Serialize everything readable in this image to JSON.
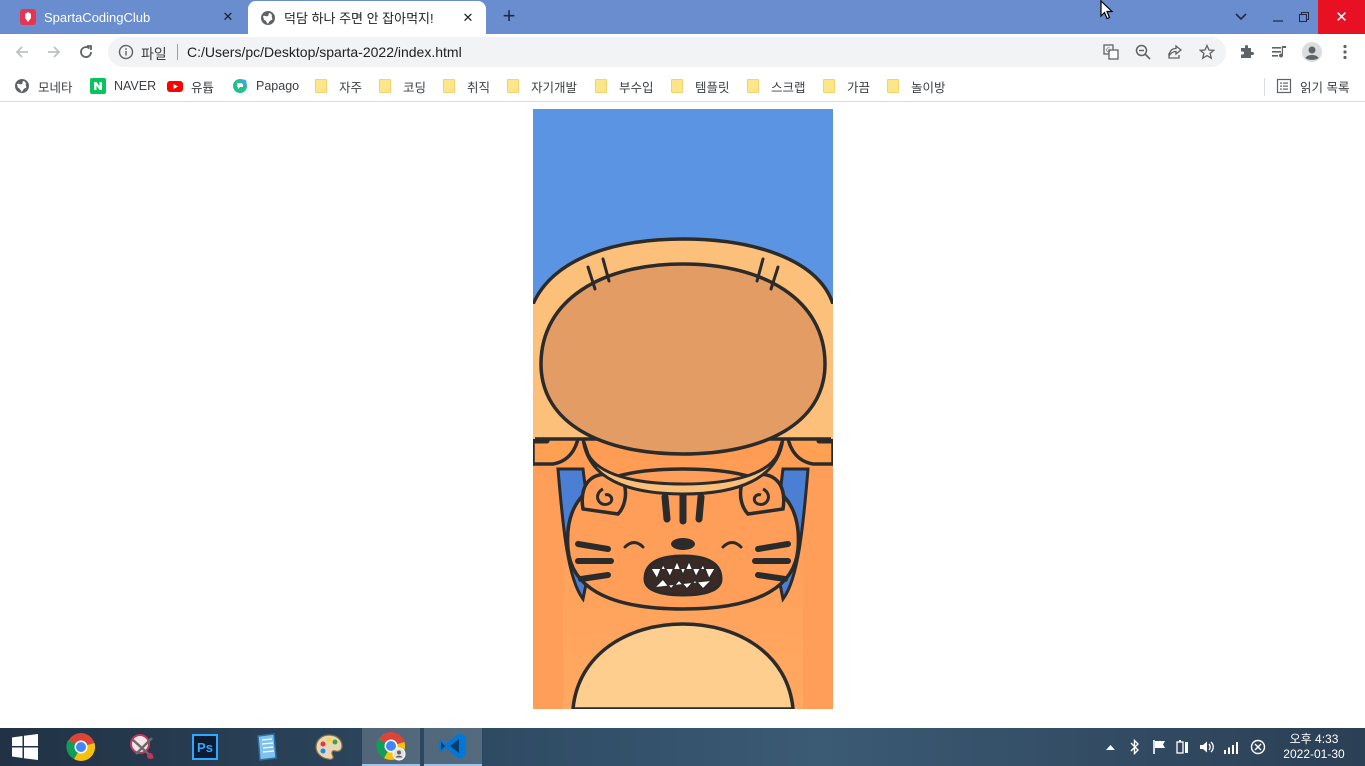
{
  "colors": {
    "tab_strip": "#6a8dcf",
    "close_button": "#e81123",
    "sky": "#5b94e3",
    "body_orange": "#ffa15a",
    "belly": "#fdce8d",
    "basket": "#e39d64"
  },
  "tabs": [
    {
      "title": "SpartaCodingClub",
      "icon": "sparta-favicon-icon",
      "active": false
    },
    {
      "title": "덕담 하나 주면 안 잡아먹지!",
      "icon": "globe-icon",
      "active": true
    }
  ],
  "window_controls": [
    "tab-search-icon",
    "minimize-icon",
    "restore-icon",
    "close-icon"
  ],
  "toolbar": {
    "back": "arrow-left-icon",
    "forward": "arrow-right-icon",
    "reload": "reload-icon",
    "site_label": "파일",
    "url": "C:/Users/pc/Desktop/sparta-2022/index.html",
    "omnibox_icons": [
      "translate-icon",
      "zoom-out-icon",
      "share-icon",
      "star-icon"
    ],
    "right_icons": [
      "extensions-icon",
      "media-icon",
      "profile-icon",
      "menu-icon"
    ]
  },
  "bookmarks": [
    {
      "label": "모네타",
      "type": "site",
      "icon": "globe-icon"
    },
    {
      "label": "NAVER",
      "type": "site",
      "icon": "naver-icon"
    },
    {
      "label": "유튭",
      "type": "site",
      "icon": "youtube-icon"
    },
    {
      "label": "Papago",
      "type": "site",
      "icon": "papago-icon"
    },
    {
      "label": "자주",
      "type": "folder",
      "icon": "folder-icon"
    },
    {
      "label": "코딩",
      "type": "folder",
      "icon": "folder-icon"
    },
    {
      "label": "취직",
      "type": "folder",
      "icon": "folder-icon"
    },
    {
      "label": "자기개발",
      "type": "folder",
      "icon": "folder-icon"
    },
    {
      "label": "부수입",
      "type": "folder",
      "icon": "folder-icon"
    },
    {
      "label": "템플릿",
      "type": "folder",
      "icon": "folder-icon"
    },
    {
      "label": "스크랩",
      "type": "folder",
      "icon": "folder-icon"
    },
    {
      "label": "가끔",
      "type": "folder",
      "icon": "folder-icon"
    },
    {
      "label": "놀이방",
      "type": "folder",
      "icon": "folder-icon"
    }
  ],
  "reading_list": {
    "label": "읽기 목록",
    "icon": "reading-list-icon"
  },
  "taskbar": {
    "apps": [
      {
        "name": "start-button",
        "icon": "windows-icon"
      },
      {
        "name": "chrome-app",
        "icon": "chrome-icon"
      },
      {
        "name": "paint-tool-app",
        "icon": "scissors-icon"
      },
      {
        "name": "photoshop-app",
        "icon": "photoshop-icon",
        "text": "Ps"
      },
      {
        "name": "notepad-app",
        "icon": "notepad-icon"
      },
      {
        "name": "paint-app",
        "icon": "palette-icon"
      },
      {
        "name": "chrome-profile-app",
        "icon": "chrome-icon",
        "active": true
      },
      {
        "name": "vscode-app",
        "icon": "vscode-icon",
        "active": true
      }
    ],
    "tray_icons": [
      "chevron-up-icon",
      "bluetooth-icon",
      "flag-icon",
      "battery-icon",
      "volume-icon",
      "network-icon",
      "notification-icon"
    ],
    "clock": {
      "time": "오후 4:33",
      "date": "2022-01-30"
    }
  }
}
